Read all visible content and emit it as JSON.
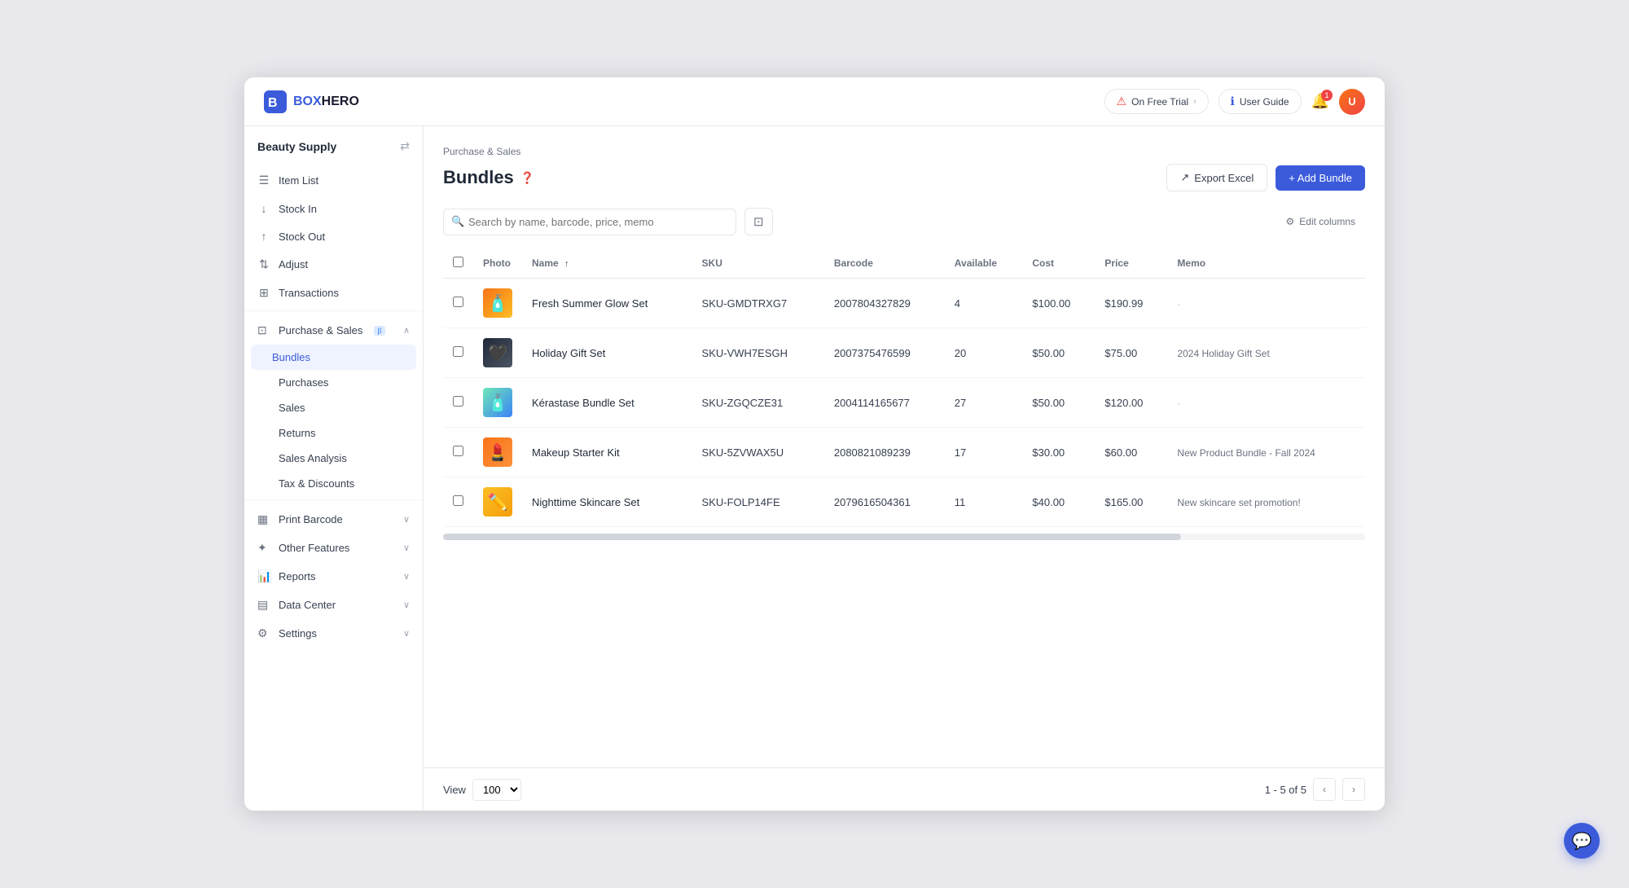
{
  "app": {
    "logo_box": "BOX",
    "logo_hero": "HERO"
  },
  "header": {
    "free_trial_label": "On Free Trial",
    "user_guide_label": "User Guide",
    "notif_count": "1",
    "avatar_initials": "U"
  },
  "sidebar": {
    "workspace_name": "Beauty Supply",
    "collapse_icon": "⇄",
    "nav_items": [
      {
        "id": "item-list",
        "label": "Item List",
        "icon": "☰"
      },
      {
        "id": "stock-in",
        "label": "Stock In",
        "icon": "↓"
      },
      {
        "id": "stock-out",
        "label": "Stock Out",
        "icon": "↑"
      },
      {
        "id": "adjust",
        "label": "Adjust",
        "icon": "⇅"
      },
      {
        "id": "transactions",
        "label": "Transactions",
        "icon": "⊞"
      }
    ],
    "purchase_sales_label": "Purchase & Sales",
    "purchase_sales_beta": "β",
    "sub_items": [
      {
        "id": "bundles",
        "label": "Bundles",
        "active": true
      },
      {
        "id": "purchases",
        "label": "Purchases",
        "active": false
      },
      {
        "id": "sales",
        "label": "Sales",
        "active": false
      },
      {
        "id": "returns",
        "label": "Returns",
        "active": false
      },
      {
        "id": "sales-analysis",
        "label": "Sales Analysis",
        "active": false
      },
      {
        "id": "tax-discounts",
        "label": "Tax & Discounts",
        "active": false
      }
    ],
    "bottom_items": [
      {
        "id": "print-barcode",
        "label": "Print Barcode",
        "icon": "▦",
        "has_chevron": true
      },
      {
        "id": "other-features",
        "label": "Other Features",
        "icon": "✦",
        "has_chevron": true
      },
      {
        "id": "reports",
        "label": "Reports",
        "icon": "📊",
        "has_chevron": true
      },
      {
        "id": "data-center",
        "label": "Data Center",
        "icon": "▤",
        "has_chevron": true
      },
      {
        "id": "settings",
        "label": "Settings",
        "icon": "⚙",
        "has_chevron": true
      }
    ]
  },
  "breadcrumb": "Purchase & Sales",
  "page": {
    "title": "Bundles",
    "export_label": "Export Excel",
    "add_label": "+ Add Bundle",
    "edit_columns_label": "Edit columns",
    "search_placeholder": "Search by name, barcode, price, memo"
  },
  "table": {
    "columns": [
      "Photo",
      "Name",
      "SKU",
      "Barcode",
      "Available",
      "Cost",
      "Price",
      "Memo"
    ],
    "rows": [
      {
        "photo_color": "prod-1",
        "photo_emoji": "🧴",
        "name": "Fresh Summer Glow Set",
        "sku": "SKU-GMDTRXG7",
        "barcode": "2007804327829",
        "available": "4",
        "cost": "$100.00",
        "price": "$190.99",
        "memo": "-"
      },
      {
        "photo_color": "prod-2",
        "photo_emoji": "🖤",
        "name": "Holiday Gift Set",
        "sku": "SKU-VWH7ESGH",
        "barcode": "2007375476599",
        "available": "20",
        "cost": "$50.00",
        "price": "$75.00",
        "memo": "2024 Holiday Gift Set"
      },
      {
        "photo_color": "prod-3",
        "photo_emoji": "🧴",
        "name": "Kérastase Bundle Set",
        "sku": "SKU-ZGQCZE31",
        "barcode": "2004114165677",
        "available": "27",
        "cost": "$50.00",
        "price": "$120.00",
        "memo": "-"
      },
      {
        "photo_color": "prod-4",
        "photo_emoji": "💄",
        "name": "Makeup Starter Kit",
        "sku": "SKU-5ZVWAX5U",
        "barcode": "2080821089239",
        "available": "17",
        "cost": "$30.00",
        "price": "$60.00",
        "memo": "New Product Bundle - Fall 2024"
      },
      {
        "photo_color": "prod-5",
        "photo_emoji": "✏️",
        "name": "Nighttime Skincare Set",
        "sku": "SKU-FOLP14FE",
        "barcode": "2079616504361",
        "available": "11",
        "cost": "$40.00",
        "price": "$165.00",
        "memo": "New skincare set promotion!"
      }
    ]
  },
  "footer": {
    "view_label": "View",
    "view_value": "100",
    "pagination": "1 - 5 of 5"
  }
}
